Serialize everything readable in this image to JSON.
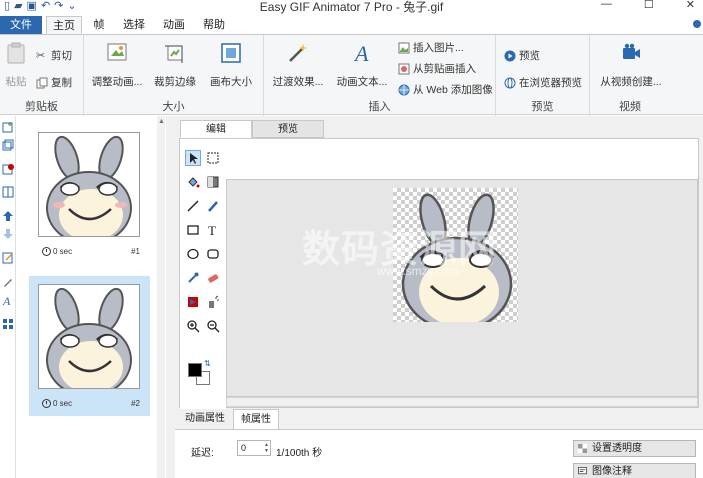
{
  "window": {
    "title": "Easy GIF Animator 7 Pro - 兔子.gif",
    "controls": {
      "minimize": "—",
      "maximize": "☐",
      "close": "✕"
    }
  },
  "qat": {
    "icons": [
      "new-icon",
      "open-icon",
      "save-icon",
      "undo-icon",
      "redo-icon",
      "dropdown-icon"
    ]
  },
  "tabs": {
    "file": "文件",
    "home": "主页",
    "frame": "帧",
    "select": "选择",
    "animation": "动画",
    "help": "帮助"
  },
  "ribbon": {
    "clipboard": {
      "label": "剪贴板",
      "paste": "粘贴",
      "cut": "剪切",
      "copy": "复制"
    },
    "size": {
      "label": "大小",
      "resize": "调整动画...",
      "crop": "裁剪边缘",
      "canvas": "画布大小"
    },
    "insert": {
      "label": "插入",
      "transition": "过渡效果...",
      "text": "动画文本...",
      "insert_image": "插入图片...",
      "from_clipboard": "从剪贴画插入",
      "from_web": "从 Web 添加图像"
    },
    "preview": {
      "label": "预览",
      "preview": "预览",
      "browser": "在浏览器预览"
    },
    "video": {
      "label": "视频",
      "from_video": "从视频创建..."
    }
  },
  "frames": [
    {
      "time": "0 sec",
      "number": "#1",
      "selected": false
    },
    {
      "time": "0 sec",
      "number": "#2",
      "selected": true
    }
  ],
  "editor": {
    "tabs": {
      "edit": "编辑",
      "preview": "预览"
    },
    "watermark": "数码资源网",
    "watermark_url": "www.smzy.com"
  },
  "props": {
    "tabs": {
      "anim": "动画属性",
      "frame": "帧属性"
    },
    "delay_label": "延迟:",
    "delay_value": "0",
    "delay_unit": "1/100th 秒",
    "set_transparency": "设置透明度",
    "image_comment": "图像注释"
  },
  "colors": {
    "accent": "#2b68b0",
    "selected_frame": "#cce4f7",
    "foreground": "#000000",
    "background": "#ffffff"
  }
}
